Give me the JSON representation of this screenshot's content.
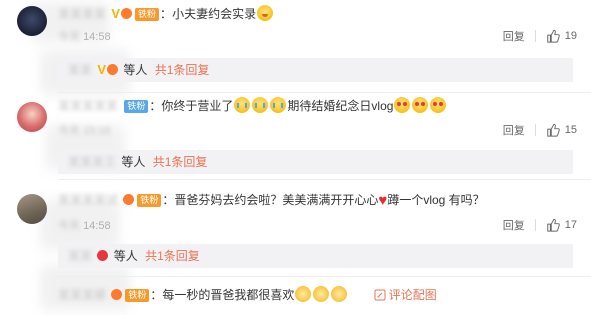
{
  "comments": [
    {
      "badge": "铁粉",
      "text": "小夫妻约会实录",
      "time_prefix": "今天",
      "time": "14:58",
      "reply_label": "回复",
      "likes": "19",
      "replies_summary": {
        "others": "等人",
        "count_text": "共1条回复"
      }
    },
    {
      "badge": "铁粉",
      "text_before": "你终于营业了",
      "text_after": "期待结婚纪念日vlog",
      "time_prefix": "今天",
      "time": "15:16",
      "reply_label": "回复",
      "likes": "15",
      "replies_summary": {
        "others": "等人",
        "count_text": "共1条回复"
      }
    },
    {
      "badge": "铁粉",
      "text_before": "晋爸芬妈去约会啦？美美满满开开心心",
      "text_after": "蹲一个vlog 有吗？",
      "time_prefix": "今天",
      "time": "14:58",
      "reply_label": "回复",
      "likes": "17",
      "replies_summary": {
        "others": "等人",
        "count_text": "共1条回复"
      }
    },
    {
      "badge": "铁粉",
      "text": "每一秒的晋爸我都很喜欢",
      "comment_link": "评论配图"
    }
  ],
  "colors": {
    "accent": "#eb7350",
    "badge_orange": "#f69a2c",
    "badge_blue": "#5aa7e6",
    "reply_bg": "#f2f2f5"
  },
  "icons": {
    "like": "thumbs-up-icon",
    "vip": "vip-v-icon",
    "pencil": "pencil-icon"
  }
}
